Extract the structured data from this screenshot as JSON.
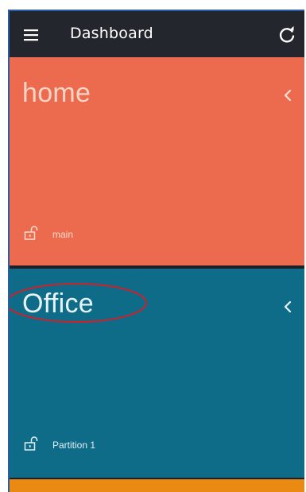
{
  "appbar": {
    "title": "Dashboard",
    "menu_icon": "hamburger-menu-icon",
    "refresh_icon": "refresh-icon",
    "background": "#23262d"
  },
  "areas": [
    {
      "name": "home",
      "color": "#ec6b4e",
      "partition": {
        "label": "main",
        "icon": "unlocked-padlock-icon"
      },
      "expand_icon": "chevron-left-icon"
    },
    {
      "name": "Office",
      "color": "#0e6c88",
      "partition": {
        "label": "Partition 1",
        "icon": "unlocked-padlock-icon"
      },
      "expand_icon": "chevron-left-icon"
    },
    {
      "name": "",
      "color": "#ea8a12"
    }
  ],
  "annotation": {
    "shape": "ellipse",
    "color": "#d0202a",
    "encircles": "Office"
  }
}
